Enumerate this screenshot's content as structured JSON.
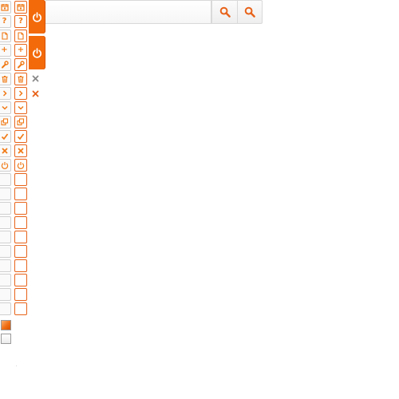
{
  "search": {
    "value": "",
    "placeholder": ""
  },
  "icon_rows": [
    {
      "icon": "calendar-icon",
      "glyph": ""
    },
    {
      "icon": "help-icon",
      "glyph": "?"
    },
    {
      "icon": "document-icon",
      "glyph": ""
    },
    {
      "icon": "plus-icon",
      "glyph": "+"
    },
    {
      "icon": "wrench-icon",
      "glyph": ""
    },
    {
      "icon": "trash-icon",
      "glyph": ""
    },
    {
      "icon": "chevron-right-icon",
      "glyph": ""
    },
    {
      "icon": "chevron-down-icon",
      "glyph": ""
    },
    {
      "icon": "copy-icon",
      "glyph": ""
    },
    {
      "icon": "check-icon",
      "glyph": ""
    },
    {
      "icon": "close-icon",
      "glyph": ""
    },
    {
      "icon": "power-icon",
      "glyph": ""
    },
    {
      "icon": "",
      "glyph": ""
    },
    {
      "icon": "",
      "glyph": ""
    },
    {
      "icon": "",
      "glyph": ""
    },
    {
      "icon": "",
      "glyph": ""
    },
    {
      "icon": "",
      "glyph": ""
    },
    {
      "icon": "",
      "glyph": ""
    },
    {
      "icon": "",
      "glyph": ""
    },
    {
      "icon": "",
      "glyph": ""
    },
    {
      "icon": "",
      "glyph": ""
    },
    {
      "icon": "",
      "glyph": ""
    }
  ],
  "colors": {
    "accent": "#f36a0a",
    "accent_dark": "#d85300",
    "icon_orange": "#f07a17",
    "border_gray": "#cfcfcf",
    "border_orange": "#e8631a",
    "x_gray": "#8a8a8a"
  }
}
